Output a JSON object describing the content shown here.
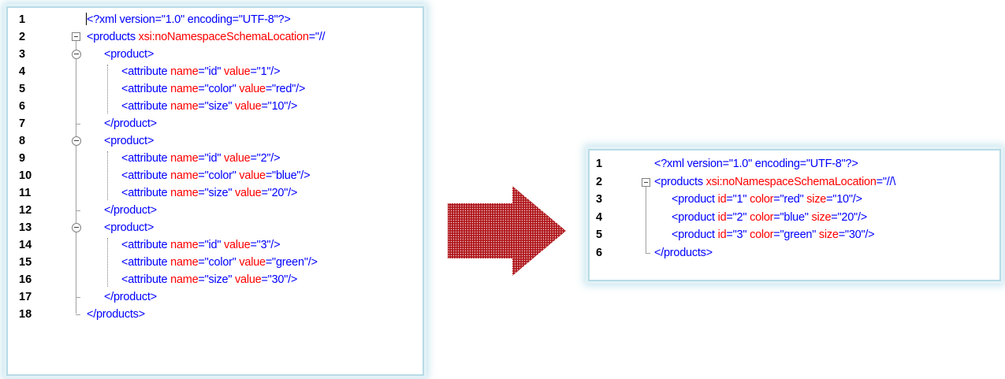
{
  "left_editor": {
    "lines": [
      {
        "n": "1",
        "indent": 0,
        "parts": [
          [
            "decl",
            "<?xml version=\"1.0\" encoding=\"UTF-8\"?>"
          ]
        ]
      },
      {
        "n": "2",
        "indent": 0,
        "parts": [
          [
            "tag",
            "<products "
          ],
          [
            "aname",
            "xsi:noNamespaceSchemaLocation"
          ],
          [
            "tag",
            "=\"//"
          ]
        ]
      },
      {
        "n": "3",
        "indent": 1,
        "parts": [
          [
            "tag",
            "<product>"
          ]
        ]
      },
      {
        "n": "4",
        "indent": 2,
        "parts": [
          [
            "tag",
            "<attribute "
          ],
          [
            "aname",
            "name"
          ],
          [
            "tag",
            "=\""
          ],
          [
            "aval",
            "id"
          ],
          [
            "tag",
            "\" "
          ],
          [
            "aname",
            "value"
          ],
          [
            "tag",
            "=\""
          ],
          [
            "aval",
            "1"
          ],
          [
            "tag",
            "\"/>"
          ]
        ]
      },
      {
        "n": "5",
        "indent": 2,
        "parts": [
          [
            "tag",
            "<attribute "
          ],
          [
            "aname",
            "name"
          ],
          [
            "tag",
            "=\""
          ],
          [
            "aval",
            "color"
          ],
          [
            "tag",
            "\" "
          ],
          [
            "aname",
            "value"
          ],
          [
            "tag",
            "=\""
          ],
          [
            "aval",
            "red"
          ],
          [
            "tag",
            "\"/>"
          ]
        ]
      },
      {
        "n": "6",
        "indent": 2,
        "parts": [
          [
            "tag",
            "<attribute "
          ],
          [
            "aname",
            "name"
          ],
          [
            "tag",
            "=\""
          ],
          [
            "aval",
            "size"
          ],
          [
            "tag",
            "\" "
          ],
          [
            "aname",
            "value"
          ],
          [
            "tag",
            "=\""
          ],
          [
            "aval",
            "10"
          ],
          [
            "tag",
            "\"/>"
          ]
        ]
      },
      {
        "n": "7",
        "indent": 1,
        "parts": [
          [
            "tag",
            "</product>"
          ]
        ]
      },
      {
        "n": "8",
        "indent": 1,
        "parts": [
          [
            "tag",
            "<product>"
          ]
        ]
      },
      {
        "n": "9",
        "indent": 2,
        "parts": [
          [
            "tag",
            "<attribute "
          ],
          [
            "aname",
            "name"
          ],
          [
            "tag",
            "=\""
          ],
          [
            "aval",
            "id"
          ],
          [
            "tag",
            "\" "
          ],
          [
            "aname",
            "value"
          ],
          [
            "tag",
            "=\""
          ],
          [
            "aval",
            "2"
          ],
          [
            "tag",
            "\"/>"
          ]
        ]
      },
      {
        "n": "10",
        "indent": 2,
        "parts": [
          [
            "tag",
            "<attribute "
          ],
          [
            "aname",
            "name"
          ],
          [
            "tag",
            "=\""
          ],
          [
            "aval",
            "color"
          ],
          [
            "tag",
            "\" "
          ],
          [
            "aname",
            "value"
          ],
          [
            "tag",
            "=\""
          ],
          [
            "aval",
            "blue"
          ],
          [
            "tag",
            "\"/>"
          ]
        ]
      },
      {
        "n": "11",
        "indent": 2,
        "parts": [
          [
            "tag",
            "<attribute "
          ],
          [
            "aname",
            "name"
          ],
          [
            "tag",
            "=\""
          ],
          [
            "aval",
            "size"
          ],
          [
            "tag",
            "\" "
          ],
          [
            "aname",
            "value"
          ],
          [
            "tag",
            "=\""
          ],
          [
            "aval",
            "20"
          ],
          [
            "tag",
            "\"/>"
          ]
        ]
      },
      {
        "n": "12",
        "indent": 1,
        "parts": [
          [
            "tag",
            "</product>"
          ]
        ]
      },
      {
        "n": "13",
        "indent": 1,
        "parts": [
          [
            "tag",
            "<product>"
          ]
        ]
      },
      {
        "n": "14",
        "indent": 2,
        "parts": [
          [
            "tag",
            "<attribute "
          ],
          [
            "aname",
            "name"
          ],
          [
            "tag",
            "=\""
          ],
          [
            "aval",
            "id"
          ],
          [
            "tag",
            "\" "
          ],
          [
            "aname",
            "value"
          ],
          [
            "tag",
            "=\""
          ],
          [
            "aval",
            "3"
          ],
          [
            "tag",
            "\"/>"
          ]
        ]
      },
      {
        "n": "15",
        "indent": 2,
        "parts": [
          [
            "tag",
            "<attribute "
          ],
          [
            "aname",
            "name"
          ],
          [
            "tag",
            "=\""
          ],
          [
            "aval",
            "color"
          ],
          [
            "tag",
            "\" "
          ],
          [
            "aname",
            "value"
          ],
          [
            "tag",
            "=\""
          ],
          [
            "aval",
            "green"
          ],
          [
            "tag",
            "\"/>"
          ]
        ]
      },
      {
        "n": "16",
        "indent": 2,
        "parts": [
          [
            "tag",
            "<attribute "
          ],
          [
            "aname",
            "name"
          ],
          [
            "tag",
            "=\""
          ],
          [
            "aval",
            "size"
          ],
          [
            "tag",
            "\" "
          ],
          [
            "aname",
            "value"
          ],
          [
            "tag",
            "=\""
          ],
          [
            "aval",
            "30"
          ],
          [
            "tag",
            "\"/>"
          ]
        ]
      },
      {
        "n": "17",
        "indent": 1,
        "parts": [
          [
            "tag",
            "</product>"
          ]
        ]
      },
      {
        "n": "18",
        "indent": 0,
        "parts": [
          [
            "tag",
            "</products>"
          ]
        ]
      }
    ]
  },
  "right_editor": {
    "lines": [
      {
        "n": "1",
        "indent": 0,
        "parts": [
          [
            "decl",
            "<?xml version=\"1.0\" encoding=\"UTF-8\"?>"
          ]
        ]
      },
      {
        "n": "2",
        "indent": 0,
        "parts": [
          [
            "tag",
            "<products "
          ],
          [
            "aname",
            "xsi:noNamespaceSchemaLocation"
          ],
          [
            "tag",
            "=\"//\\"
          ]
        ]
      },
      {
        "n": "3",
        "indent": 1,
        "parts": [
          [
            "tag",
            "<product "
          ],
          [
            "aname",
            "id"
          ],
          [
            "tag",
            "=\""
          ],
          [
            "aval",
            "1"
          ],
          [
            "tag",
            "\" "
          ],
          [
            "aname",
            "color"
          ],
          [
            "tag",
            "=\""
          ],
          [
            "aval",
            "red"
          ],
          [
            "tag",
            "\" "
          ],
          [
            "aname",
            "size"
          ],
          [
            "tag",
            "=\""
          ],
          [
            "aval",
            "10"
          ],
          [
            "tag",
            "\"/>"
          ]
        ]
      },
      {
        "n": "4",
        "indent": 1,
        "parts": [
          [
            "tag",
            "<product "
          ],
          [
            "aname",
            "id"
          ],
          [
            "tag",
            "=\""
          ],
          [
            "aval",
            "2"
          ],
          [
            "tag",
            "\" "
          ],
          [
            "aname",
            "color"
          ],
          [
            "tag",
            "=\""
          ],
          [
            "aval",
            "blue"
          ],
          [
            "tag",
            "\" "
          ],
          [
            "aname",
            "size"
          ],
          [
            "tag",
            "=\""
          ],
          [
            "aval",
            "20"
          ],
          [
            "tag",
            "\"/>"
          ]
        ]
      },
      {
        "n": "5",
        "indent": 1,
        "parts": [
          [
            "tag",
            "<product "
          ],
          [
            "aname",
            "id"
          ],
          [
            "tag",
            "=\""
          ],
          [
            "aval",
            "3"
          ],
          [
            "tag",
            "\" "
          ],
          [
            "aname",
            "color"
          ],
          [
            "tag",
            "=\""
          ],
          [
            "aval",
            "green"
          ],
          [
            "tag",
            "\" "
          ],
          [
            "aname",
            "size"
          ],
          [
            "tag",
            "=\""
          ],
          [
            "aval",
            "30"
          ],
          [
            "tag",
            "\"/>"
          ]
        ]
      },
      {
        "n": "6",
        "indent": 0,
        "parts": [
          [
            "tag",
            "</products>"
          ]
        ]
      }
    ]
  },
  "arrow": {
    "icon": "right-arrow-icon",
    "color": "#b0191e"
  },
  "colors": {
    "tag": "#0000ff",
    "attribute_name": "#ff0000",
    "attribute_value": "#0000ff",
    "panel_glow": "#b7dbe6"
  }
}
